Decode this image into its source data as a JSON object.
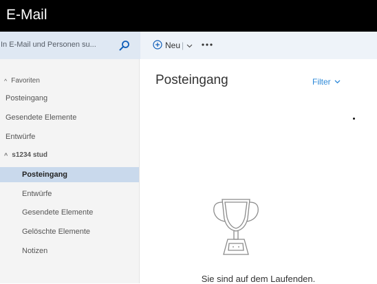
{
  "app": {
    "title": "E-Mail"
  },
  "search": {
    "placeholder": "In E-Mail und Personen su..."
  },
  "toolbar": {
    "new_label": "Neu",
    "more_label": "•••"
  },
  "sidebar": {
    "favorites": {
      "label": "Favoriten",
      "items": [
        "Posteingang",
        "Gesendete Elemente",
        "Entwürfe"
      ]
    },
    "account": {
      "label": "s1234 stud",
      "items": [
        "Posteingang",
        "Entwürfe",
        "Gesendete Elemente",
        "Gelöschte Elemente",
        "Notizen"
      ],
      "selected": "Posteingang"
    }
  },
  "main": {
    "heading": "Posteingang",
    "filter_label": "Filter",
    "empty_message": "Sie sind auf dem Laufenden."
  },
  "colors": {
    "titlebar": "#000000",
    "search_bg": "#dfe8f3",
    "command_bg": "#eef3f9",
    "sidebar_bg": "#f4f4f4",
    "selected_bg": "#c9d9ec",
    "accent": "#2b88d8"
  },
  "icons": [
    "search-icon",
    "plus-circle-icon",
    "chevron-down-icon",
    "more-icon",
    "caret-icon",
    "trophy-icon"
  ]
}
